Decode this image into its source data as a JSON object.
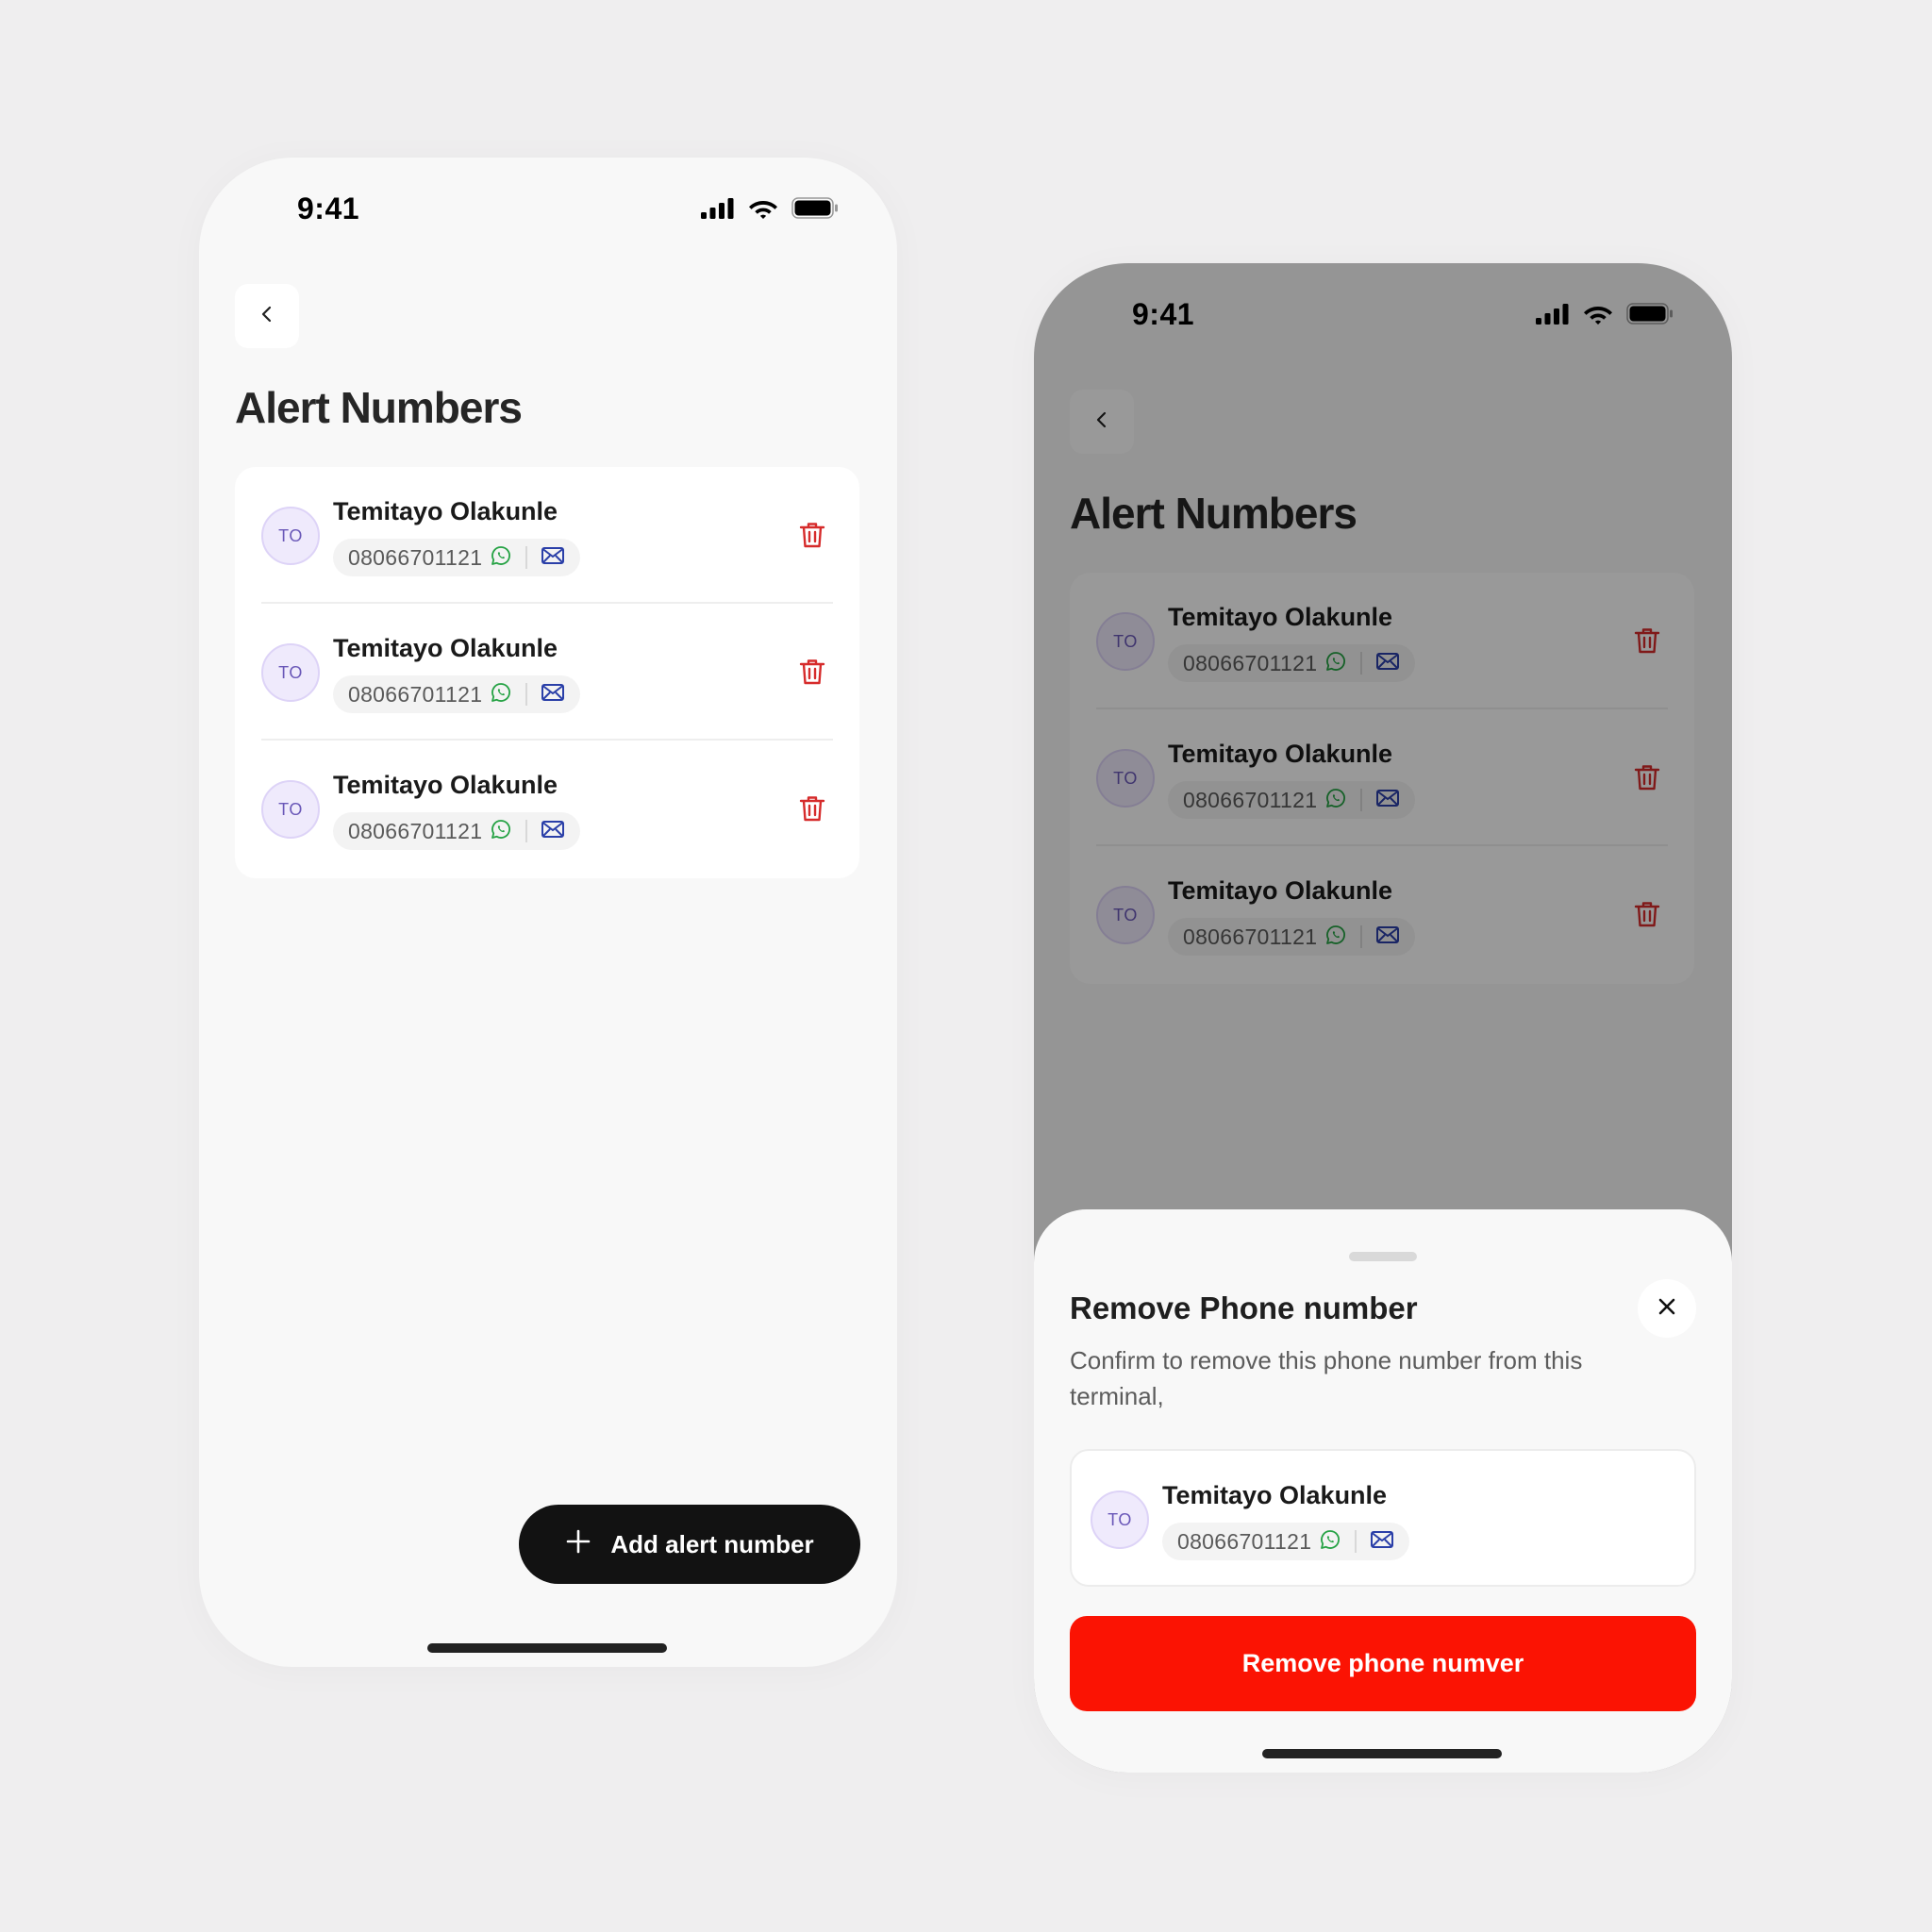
{
  "colors": {
    "background": "#efeeef",
    "phone_bg": "#f8f8f8",
    "danger": "#fb1303",
    "trash": "#d62b2b",
    "whatsapp": "#25a244",
    "mail": "#2a3fa8",
    "avatar_text": "#6a58b8"
  },
  "screens": [
    {
      "status_bar": {
        "time": "9:41"
      },
      "title": "Alert Numbers",
      "contacts": [
        {
          "initials": "TO",
          "name": "Temitayo Olakunle",
          "phone": "08066701121"
        },
        {
          "initials": "TO",
          "name": "Temitayo Olakunle",
          "phone": "08066701121"
        },
        {
          "initials": "TO",
          "name": "Temitayo Olakunle",
          "phone": "08066701121"
        }
      ],
      "add_button_label": "Add alert number"
    },
    {
      "status_bar": {
        "time": "9:41"
      },
      "title": "Alert Numbers",
      "contacts": [
        {
          "initials": "TO",
          "name": "Temitayo Olakunle",
          "phone": "08066701121"
        },
        {
          "initials": "TO",
          "name": "Temitayo Olakunle",
          "phone": "08066701121"
        },
        {
          "initials": "TO",
          "name": "Temitayo Olakunle",
          "phone": "08066701121"
        }
      ],
      "sheet": {
        "title": "Remove Phone number",
        "description": "Confirm to remove this phone number from this terminal,",
        "contact": {
          "initials": "TO",
          "name": "Temitayo Olakunle",
          "phone": "08066701121"
        },
        "confirm_label": "Remove phone numver"
      }
    }
  ],
  "icons": {
    "back": "chevron-left-icon",
    "trash": "trash-icon",
    "whatsapp": "whatsapp-icon",
    "mail": "mail-icon",
    "add": "plus-icon",
    "close": "close-icon",
    "signal": "signal-icon",
    "wifi": "wifi-icon",
    "battery": "battery-icon"
  }
}
